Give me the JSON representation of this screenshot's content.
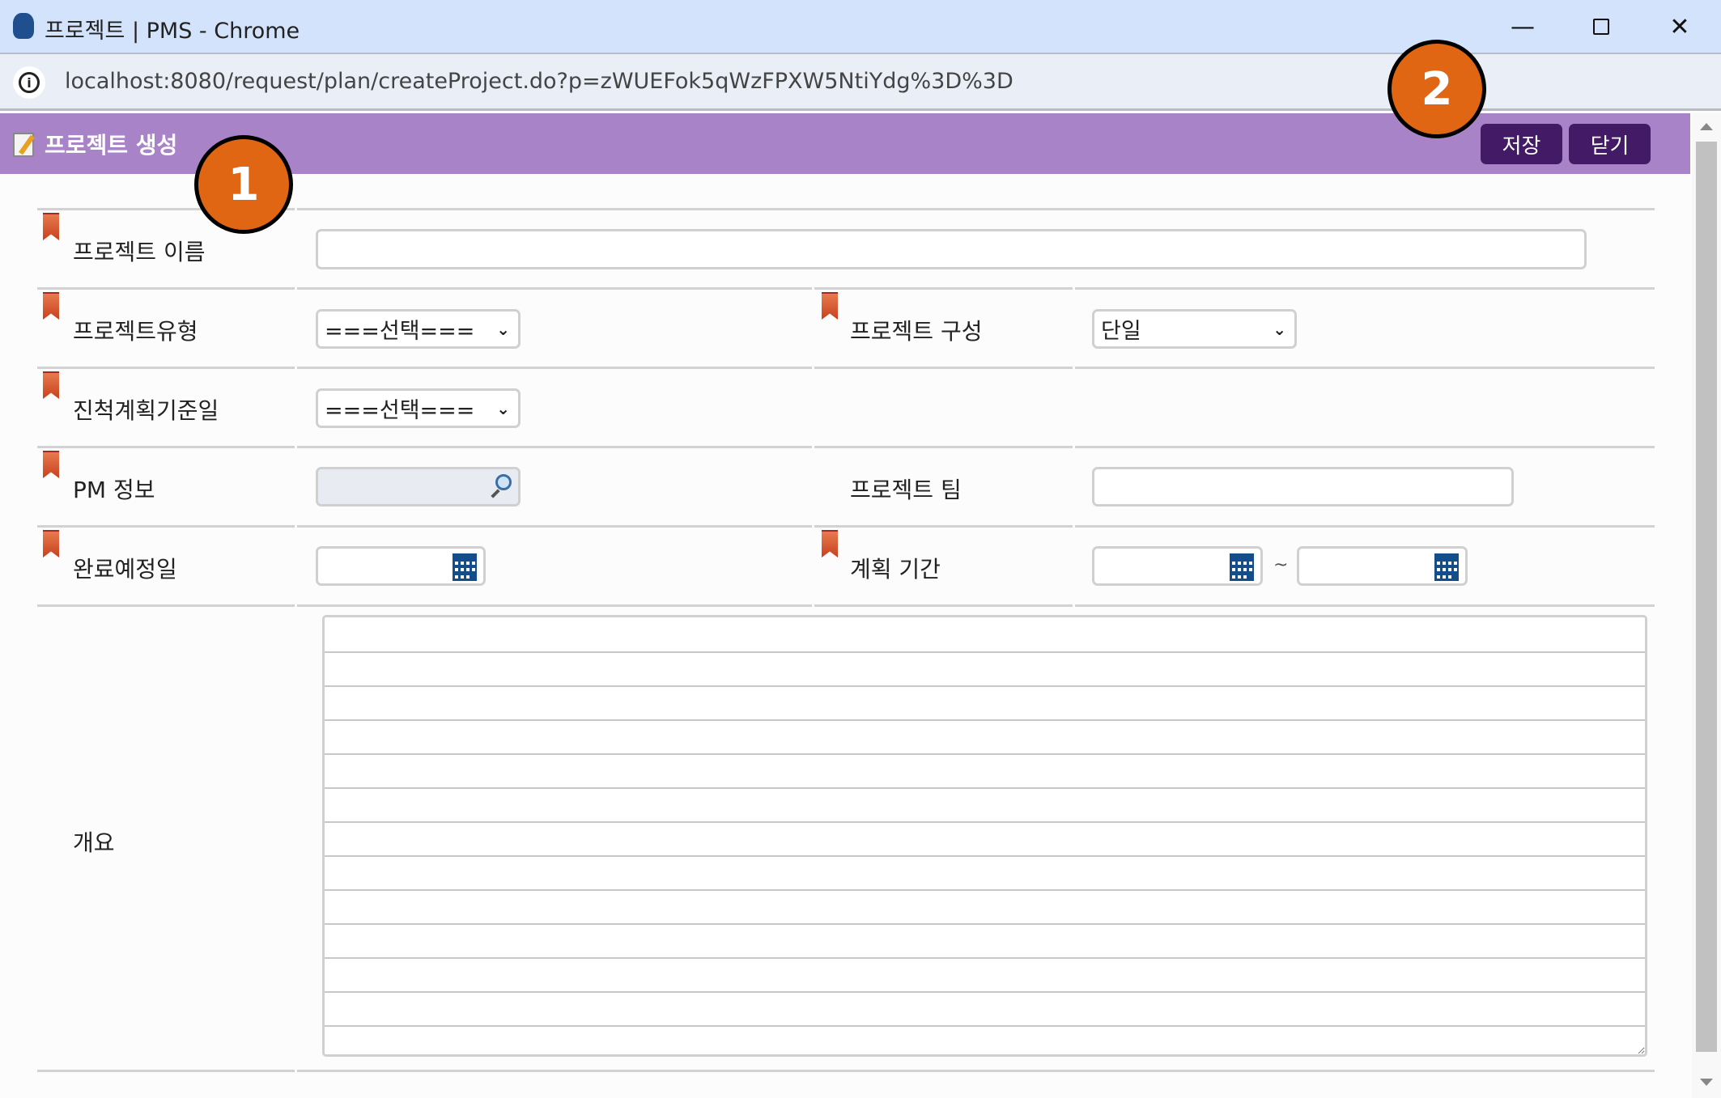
{
  "window": {
    "title": "프로젝트 | PMS - Chrome",
    "url": "localhost:8080/request/plan/createProject.do?p=zWUEFok5qWzFPXW5NtiYdg%3D%3D"
  },
  "header": {
    "title": "프로젝트 생성",
    "save_label": "저장",
    "close_label": "닫기"
  },
  "form": {
    "project_name_label": "프로젝트 이름",
    "project_name_value": "",
    "project_type_label": "프로젝트유형",
    "project_type_value": "===선택===",
    "project_structure_label": "프로젝트 구성",
    "project_structure_value": "단일",
    "progress_base_label": "진척계획기준일",
    "progress_base_value": "===선택===",
    "pm_label": "PM 정보",
    "pm_value": "",
    "team_label": "프로젝트 팀",
    "team_value": "",
    "due_label": "완료예정일",
    "due_value": "",
    "period_label": "계획 기간",
    "period_sep": "~",
    "period_start": "",
    "period_end": "",
    "summary_label": "개요",
    "summary_value": ""
  },
  "annotations": [
    "1",
    "2"
  ],
  "colors": {
    "header": "#a983c8",
    "button": "#431a66",
    "annotation": "#e06614"
  }
}
